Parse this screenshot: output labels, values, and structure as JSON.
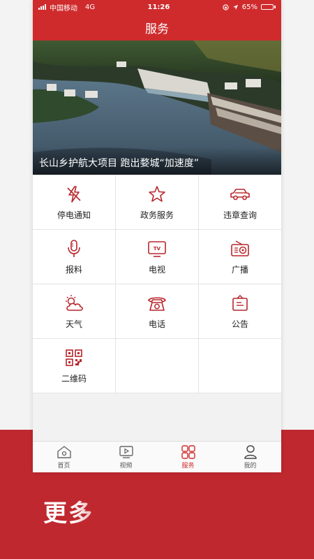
{
  "status_bar": {
    "carrier": "中国移动",
    "network": "4G",
    "time": "11:26",
    "battery": "65%",
    "battery_level": 0.65
  },
  "header": {
    "title": "服务"
  },
  "banner": {
    "caption": "长山乡护航大项目 跑出婺城“加速度”"
  },
  "services": [
    {
      "label": "停电通知",
      "icon": "power-off-icon"
    },
    {
      "label": "政务服务",
      "icon": "star-icon"
    },
    {
      "label": "违章查询",
      "icon": "car-icon"
    },
    {
      "label": "报料",
      "icon": "microphone-icon"
    },
    {
      "label": "电视",
      "icon": "tv-icon"
    },
    {
      "label": "广播",
      "icon": "radio-icon"
    },
    {
      "label": "天气",
      "icon": "weather-icon"
    },
    {
      "label": "电话",
      "icon": "telephone-icon"
    },
    {
      "label": "公告",
      "icon": "notice-icon"
    },
    {
      "label": "二维码",
      "icon": "qr-code-icon"
    }
  ],
  "tabs": [
    {
      "label": "首页",
      "icon": "home-icon",
      "active": false
    },
    {
      "label": "视频",
      "icon": "video-icon",
      "active": false
    },
    {
      "label": "服务",
      "icon": "grid-icon",
      "active": true
    },
    {
      "label": "我的",
      "icon": "user-icon",
      "active": false
    }
  ],
  "promo": {
    "text": "更多"
  },
  "colors": {
    "accent": "#cf2b2d",
    "icon": "#b8262c",
    "promo_bg": "#c0282f"
  }
}
